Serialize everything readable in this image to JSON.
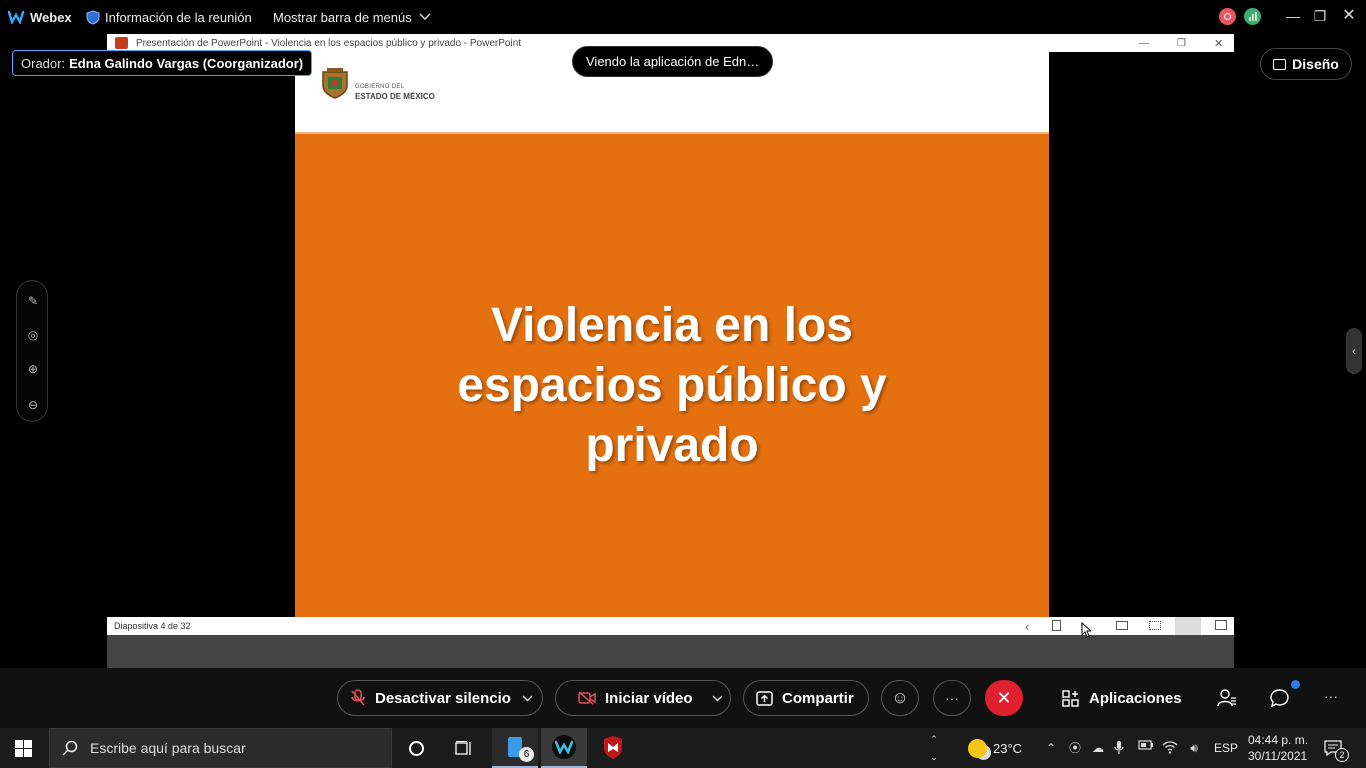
{
  "app_bar": {
    "app_name": "Webex",
    "meeting_info": "Información de la reunión",
    "show_menu_bar": "Mostrar barra de menús"
  },
  "powerpoint": {
    "window_title": "Presentación de PowerPoint  -  Violencia en los espacios público y privado  -  PowerPoint",
    "status": "Diapositiva 4 de 32",
    "slide": {
      "logo_line1": "GOBIERNO DEL",
      "logo_line2": "ESTADO DE MÉXICO",
      "title_line1": "Violencia en los",
      "title_line2": "espacios público y",
      "title_line3": "privado",
      "background_color": "#e5700f"
    }
  },
  "speaker": {
    "label": "Orador:",
    "name": "Edna Galindo Vargas (Coorganizador)"
  },
  "viewing_notice": "Viendo la aplicación de Edn…",
  "layout_button": "Diseño",
  "controls": {
    "mute": "Desactivar silencio",
    "video": "Iniciar vídeo",
    "share": "Compartir",
    "apps": "Aplicaciones",
    "end_color": "#e0202e"
  },
  "taskbar": {
    "search_placeholder": "Escribe aquí para buscar",
    "explorer_badge": "6",
    "weather": "23°C",
    "language": "ESP",
    "time": "04:44 p. m.",
    "date": "30/11/2021",
    "notifications": "2"
  }
}
